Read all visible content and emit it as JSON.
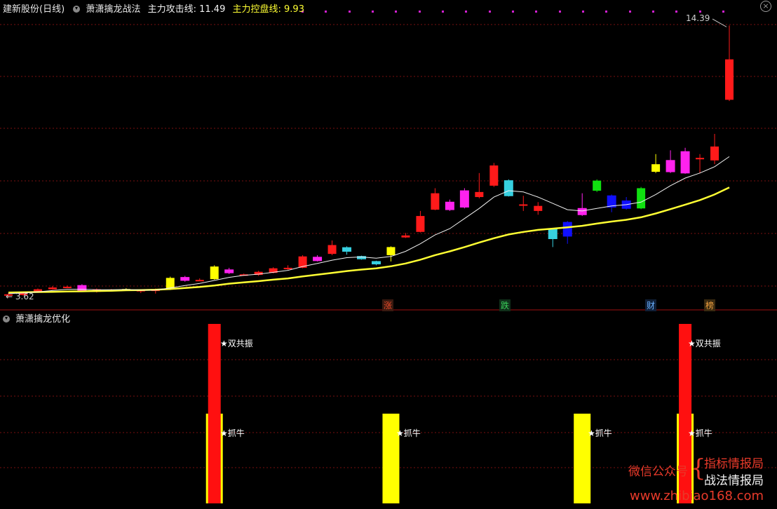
{
  "header": {
    "stock_name": "建新股份(日线)",
    "strategy_name": "萧潇擒龙战法",
    "attack_label": "主力攻击线:",
    "attack_value": "11.49",
    "control_label": "主力控盘线:",
    "control_value": "9.93",
    "close_icon": "close-icon"
  },
  "price_labels": {
    "high": "14.39",
    "low": "3.62"
  },
  "event_tags": [
    {
      "text": "涨",
      "color": "#e84a2a"
    },
    {
      "text": "跌",
      "color": "#39d05a"
    },
    {
      "text": "财",
      "color": "#6ab0ff"
    },
    {
      "text": "榜",
      "color": "#f0a040"
    }
  ],
  "sub_panel": {
    "title": "萧潇擒龙优化",
    "double_resonance": "★双共振",
    "catch_bull": "★抓牛"
  },
  "watermark": {
    "wechat": "微信公众号",
    "line1": "指标情报局",
    "line2": "战法情报局",
    "site": "www.zhibiao168.com"
  },
  "colors": {
    "up": "#ff1a1a",
    "down": "#37d0e0",
    "attack_line": "#f2f2f2",
    "control_line": "#ffff33",
    "signal_red": "#ff1010",
    "signal_yellow": "#ffff00",
    "grid": "#7a1010",
    "divider": "#a01010"
  },
  "chart_data": {
    "type": "candlestick",
    "price_range": [
      3.3,
      14.9
    ],
    "candles": [
      {
        "o": 3.75,
        "c": 3.72,
        "h": 3.8,
        "l": 3.62,
        "color": "red"
      },
      {
        "o": 3.72,
        "c": 3.8,
        "h": 3.85,
        "l": 3.7,
        "color": "red"
      },
      {
        "o": 3.85,
        "c": 3.95,
        "h": 3.98,
        "l": 3.84,
        "color": "red"
      },
      {
        "o": 3.95,
        "c": 4.02,
        "h": 4.08,
        "l": 3.94,
        "color": "red"
      },
      {
        "o": 4.05,
        "c": 4.03,
        "h": 4.1,
        "l": 4.0,
        "color": "red"
      },
      {
        "o": 4.1,
        "c": 3.9,
        "h": 4.15,
        "l": 3.85,
        "color": "magenta"
      },
      {
        "o": 3.95,
        "c": 3.85,
        "h": 3.98,
        "l": 3.82,
        "color": "red"
      },
      {
        "o": 3.92,
        "c": 3.93,
        "h": 3.96,
        "l": 3.88,
        "color": "red"
      },
      {
        "o": 3.95,
        "c": 3.96,
        "h": 3.99,
        "l": 3.92,
        "color": "yellow"
      },
      {
        "o": 3.92,
        "c": 3.88,
        "h": 3.95,
        "l": 3.8,
        "color": "red"
      },
      {
        "o": 3.88,
        "c": 3.95,
        "h": 3.98,
        "l": 3.78,
        "color": "red"
      },
      {
        "o": 3.95,
        "c": 4.4,
        "h": 4.45,
        "l": 3.92,
        "color": "yellow"
      },
      {
        "o": 4.3,
        "c": 4.42,
        "h": 4.48,
        "l": 4.25,
        "color": "magenta"
      },
      {
        "o": 4.32,
        "c": 4.31,
        "h": 4.38,
        "l": 4.28,
        "color": "red"
      },
      {
        "o": 4.35,
        "c": 4.85,
        "h": 4.9,
        "l": 4.33,
        "color": "yellow"
      },
      {
        "o": 4.6,
        "c": 4.72,
        "h": 4.8,
        "l": 4.55,
        "color": "magenta"
      },
      {
        "o": 4.52,
        "c": 4.54,
        "h": 4.57,
        "l": 4.48,
        "color": "red"
      },
      {
        "o": 4.52,
        "c": 4.64,
        "h": 4.68,
        "l": 4.48,
        "color": "red"
      },
      {
        "o": 4.6,
        "c": 4.78,
        "h": 4.82,
        "l": 4.58,
        "color": "red"
      },
      {
        "o": 4.75,
        "c": 4.8,
        "h": 4.9,
        "l": 4.72,
        "color": "red"
      },
      {
        "o": 4.8,
        "c": 5.25,
        "h": 5.3,
        "l": 4.78,
        "color": "red"
      },
      {
        "o": 5.08,
        "c": 5.22,
        "h": 5.3,
        "l": 5.05,
        "color": "magenta"
      },
      {
        "o": 5.35,
        "c": 5.7,
        "h": 5.88,
        "l": 5.3,
        "color": "red"
      },
      {
        "o": 5.45,
        "c": 5.6,
        "h": 5.65,
        "l": 5.32,
        "color": "cyan"
      },
      {
        "o": 5.25,
        "c": 5.15,
        "h": 5.28,
        "l": 5.12,
        "color": "cyan"
      },
      {
        "o": 5.05,
        "c": 4.95,
        "h": 5.08,
        "l": 4.9,
        "color": "cyan"
      },
      {
        "o": 5.3,
        "c": 5.62,
        "h": 5.65,
        "l": 5.05,
        "color": "yellow"
      },
      {
        "o": 6.0,
        "c": 6.08,
        "h": 6.18,
        "l": 5.98,
        "color": "red"
      },
      {
        "o": 6.22,
        "c": 6.85,
        "h": 7.05,
        "l": 6.2,
        "color": "red"
      },
      {
        "o": 7.1,
        "c": 7.75,
        "h": 7.95,
        "l": 7.08,
        "color": "red"
      },
      {
        "o": 7.1,
        "c": 7.4,
        "h": 7.5,
        "l": 7.05,
        "color": "magenta"
      },
      {
        "o": 7.2,
        "c": 7.85,
        "h": 7.95,
        "l": 7.15,
        "color": "magenta"
      },
      {
        "o": 7.6,
        "c": 7.8,
        "h": 8.55,
        "l": 7.55,
        "color": "red"
      },
      {
        "o": 8.05,
        "c": 8.85,
        "h": 8.95,
        "l": 8.0,
        "color": "red"
      },
      {
        "o": 8.25,
        "c": 7.65,
        "h": 8.3,
        "l": 7.62,
        "color": "cyan"
      },
      {
        "o": 7.31,
        "c": 7.29,
        "h": 7.65,
        "l": 7.05,
        "color": "red"
      },
      {
        "o": 7.25,
        "c": 7.05,
        "h": 7.4,
        "l": 6.9,
        "color": "red"
      },
      {
        "o": 6.35,
        "c": 5.95,
        "h": 6.38,
        "l": 5.62,
        "color": "cyan"
      },
      {
        "o": 6.05,
        "c": 6.6,
        "h": 6.65,
        "l": 5.75,
        "color": "blue"
      },
      {
        "o": 6.9,
        "c": 7.15,
        "h": 7.75,
        "l": 6.85,
        "color": "magenta"
      },
      {
        "o": 7.85,
        "c": 8.25,
        "h": 8.3,
        "l": 7.8,
        "color": "green"
      },
      {
        "o": 7.2,
        "c": 7.65,
        "h": 7.7,
        "l": 7.0,
        "color": "blue"
      },
      {
        "o": 7.45,
        "c": 7.15,
        "h": 7.6,
        "l": 7.1,
        "color": "blue"
      },
      {
        "o": 7.15,
        "c": 7.95,
        "h": 8.0,
        "l": 7.12,
        "color": "green"
      },
      {
        "o": 8.6,
        "c": 8.9,
        "h": 9.3,
        "l": 8.55,
        "color": "yellow"
      },
      {
        "o": 8.6,
        "c": 9.05,
        "h": 9.45,
        "l": 8.55,
        "color": "magenta"
      },
      {
        "o": 8.55,
        "c": 9.4,
        "h": 9.55,
        "l": 8.52,
        "color": "magenta"
      },
      {
        "o": 9.1,
        "c": 9.15,
        "h": 9.3,
        "l": 8.55,
        "color": "red"
      },
      {
        "o": 9.05,
        "c": 9.6,
        "h": 10.1,
        "l": 8.9,
        "color": "red"
      },
      {
        "o": 11.45,
        "c": 13.05,
        "h": 14.39,
        "l": 11.4,
        "color": "red"
      }
    ],
    "attack_line": [
      3.78,
      3.8,
      3.85,
      3.9,
      3.95,
      3.95,
      3.93,
      3.93,
      3.94,
      3.92,
      3.92,
      4.0,
      4.1,
      4.18,
      4.3,
      4.42,
      4.5,
      4.55,
      4.62,
      4.7,
      4.85,
      4.97,
      5.1,
      5.2,
      5.23,
      5.18,
      5.25,
      5.45,
      5.75,
      6.1,
      6.35,
      6.75,
      7.15,
      7.6,
      7.85,
      7.8,
      7.6,
      7.35,
      7.1,
      7.05,
      7.15,
      7.25,
      7.3,
      7.4,
      7.7,
      8.05,
      8.35,
      8.55,
      8.8,
      9.2
    ],
    "control_line": [
      3.82,
      3.83,
      3.84,
      3.85,
      3.86,
      3.87,
      3.88,
      3.89,
      3.91,
      3.92,
      3.93,
      3.96,
      4.0,
      4.04,
      4.1,
      4.17,
      4.22,
      4.27,
      4.33,
      4.38,
      4.46,
      4.53,
      4.6,
      4.67,
      4.73,
      4.78,
      4.86,
      4.97,
      5.12,
      5.3,
      5.45,
      5.62,
      5.8,
      5.97,
      6.12,
      6.22,
      6.3,
      6.35,
      6.4,
      6.46,
      6.55,
      6.63,
      6.7,
      6.8,
      6.95,
      7.12,
      7.3,
      7.48,
      7.7,
      7.98
    ],
    "signals": [
      {
        "index": 14,
        "double_resonance": true,
        "catch_bull": true
      },
      {
        "index": 26,
        "double_resonance": false,
        "catch_bull": true
      },
      {
        "index": 39,
        "double_resonance": false,
        "catch_bull": true
      },
      {
        "index": 46,
        "double_resonance": true,
        "catch_bull": true
      }
    ]
  }
}
